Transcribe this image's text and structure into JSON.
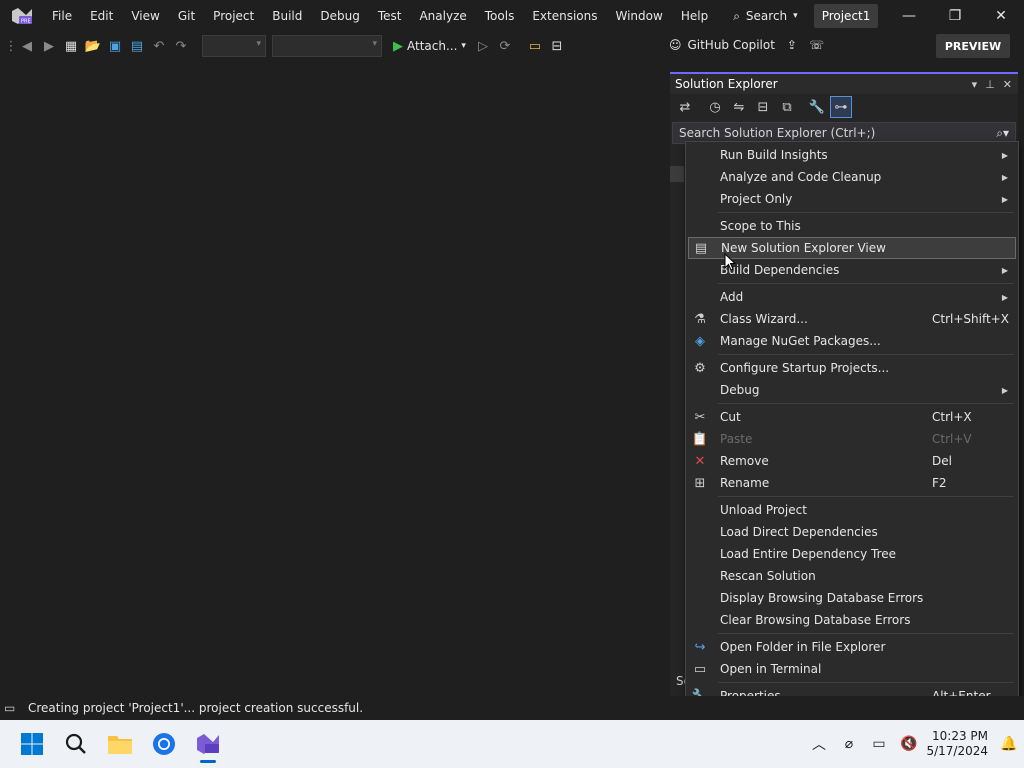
{
  "menubar": {
    "items": [
      "File",
      "Edit",
      "View",
      "Git",
      "Project",
      "Build",
      "Debug",
      "Test",
      "Analyze",
      "Tools",
      "Extensions",
      "Window",
      "Help"
    ],
    "search_label": "Search",
    "project_title": "Project1"
  },
  "toolbar": {
    "attach_label": "Attach...",
    "copilot_label": "GitHub Copilot",
    "preview_label": "PREVIEW"
  },
  "solution_explorer": {
    "title": "Solution Explorer",
    "search_placeholder": "Search Solution Explorer (Ctrl+;)",
    "bottom_label": "So"
  },
  "context_menu": {
    "groups": [
      [
        {
          "label": "Run Build Insights",
          "submenu": true
        },
        {
          "label": "Analyze and Code Cleanup",
          "submenu": true
        },
        {
          "label": "Project Only",
          "submenu": true
        }
      ],
      [
        {
          "label": "Scope to This"
        },
        {
          "label": "New Solution Explorer View",
          "icon": "new-view-icon",
          "hover": true
        },
        {
          "label": "Build Dependencies",
          "submenu": true
        }
      ],
      [
        {
          "label": "Add",
          "submenu": true
        },
        {
          "label": "Class Wizard...",
          "shortcut": "Ctrl+Shift+X",
          "icon": "class-wizard-icon"
        },
        {
          "label": "Manage NuGet Packages...",
          "icon": "nuget-icon"
        }
      ],
      [
        {
          "label": "Configure Startup Projects...",
          "icon": "gear-icon"
        },
        {
          "label": "Debug",
          "submenu": true
        }
      ],
      [
        {
          "label": "Cut",
          "shortcut": "Ctrl+X",
          "icon": "scissors-icon"
        },
        {
          "label": "Paste",
          "shortcut": "Ctrl+V",
          "icon": "paste-icon",
          "disabled": true
        },
        {
          "label": "Remove",
          "shortcut": "Del",
          "icon": "remove-icon"
        },
        {
          "label": "Rename",
          "shortcut": "F2",
          "icon": "rename-icon"
        }
      ],
      [
        {
          "label": "Unload Project"
        },
        {
          "label": "Load Direct Dependencies"
        },
        {
          "label": "Load Entire Dependency Tree"
        },
        {
          "label": "Rescan Solution"
        },
        {
          "label": "Display Browsing Database Errors"
        },
        {
          "label": "Clear Browsing Database Errors"
        }
      ],
      [
        {
          "label": "Open Folder in File Explorer",
          "icon": "open-folder-icon"
        },
        {
          "label": "Open in Terminal",
          "icon": "terminal-icon"
        }
      ],
      [
        {
          "label": "Properties",
          "shortcut": "Alt+Enter",
          "icon": "wrench-icon"
        }
      ]
    ]
  },
  "status": {
    "message": "Creating project 'Project1'... project creation successful."
  },
  "taskbar": {
    "time": "10:23 PM",
    "date": "5/17/2024"
  }
}
